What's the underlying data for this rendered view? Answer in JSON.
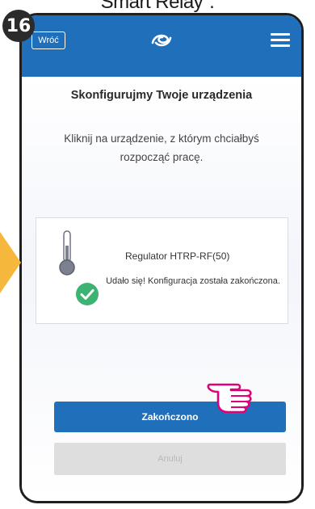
{
  "caption": "Smart Relay\".",
  "step_number": "16",
  "header": {
    "back_label": "Wróć",
    "logo_icon": "salus-logo-icon",
    "menu_icon": "hamburger-menu-icon",
    "background_color": "#1f6fba"
  },
  "main": {
    "title": "Skonfigurujmy Twoje urządzenia",
    "subtitle": "Kliknij na urządzenie, z którym chciałbyś rozpocząć pracę.",
    "device": {
      "name": "Regulator HTRP-RF(50)",
      "icon": "thermometer-icon",
      "status_icon": "check-circle-icon",
      "status_text": "Udało się! Konfiguracja została zakończona."
    },
    "buttons": {
      "done_label": "Zakończono",
      "cancel_label": "Anuluj"
    }
  },
  "colors": {
    "accent": "#1f6fba",
    "success": "#3cb371",
    "highlight": "#e0007a",
    "arrow": "#f5b83d"
  }
}
